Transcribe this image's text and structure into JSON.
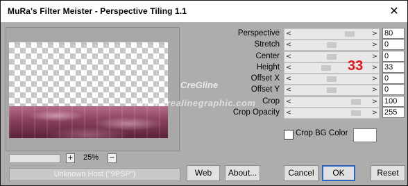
{
  "window": {
    "title": "MuRa's Filter Meister - Perspective Tiling 1.1",
    "close_glyph": "✕"
  },
  "preview": {
    "zoom_level": "25%",
    "zoom_plus": "+",
    "zoom_minus": "−",
    "host_label": "Unknown Host (\"9PSP\")"
  },
  "params": [
    {
      "label": "Perspective",
      "value": "80",
      "fraction": 0.78
    },
    {
      "label": "Stretch",
      "value": "0",
      "fraction": 0.5
    },
    {
      "label": "Center",
      "value": "0",
      "fraction": 0.5
    },
    {
      "label": "Height",
      "value": "33",
      "fraction": 0.42
    },
    {
      "label": "Offset X",
      "value": "0",
      "fraction": 0.5
    },
    {
      "label": "Offset Y",
      "value": "0",
      "fraction": 0.5
    },
    {
      "label": "Crop",
      "value": "100",
      "fraction": 0.87
    },
    {
      "label": "Crop Opacity",
      "value": "255",
      "fraction": 0.87
    }
  ],
  "arrows": {
    "left": "<",
    "right": ">"
  },
  "crop_bg": {
    "label": "Crop BG Color",
    "checked": false,
    "color": "#ffffff"
  },
  "annotation": "33",
  "watermark": {
    "line1": "CreGline",
    "line2": "www.crealinegraphic.com"
  },
  "buttons": {
    "web": "Web",
    "about": "About...",
    "cancel": "Cancel",
    "ok": "OK",
    "reset": "Reset"
  },
  "colors": {
    "floor": "#8b4462",
    "annotation": "#e5161a"
  }
}
